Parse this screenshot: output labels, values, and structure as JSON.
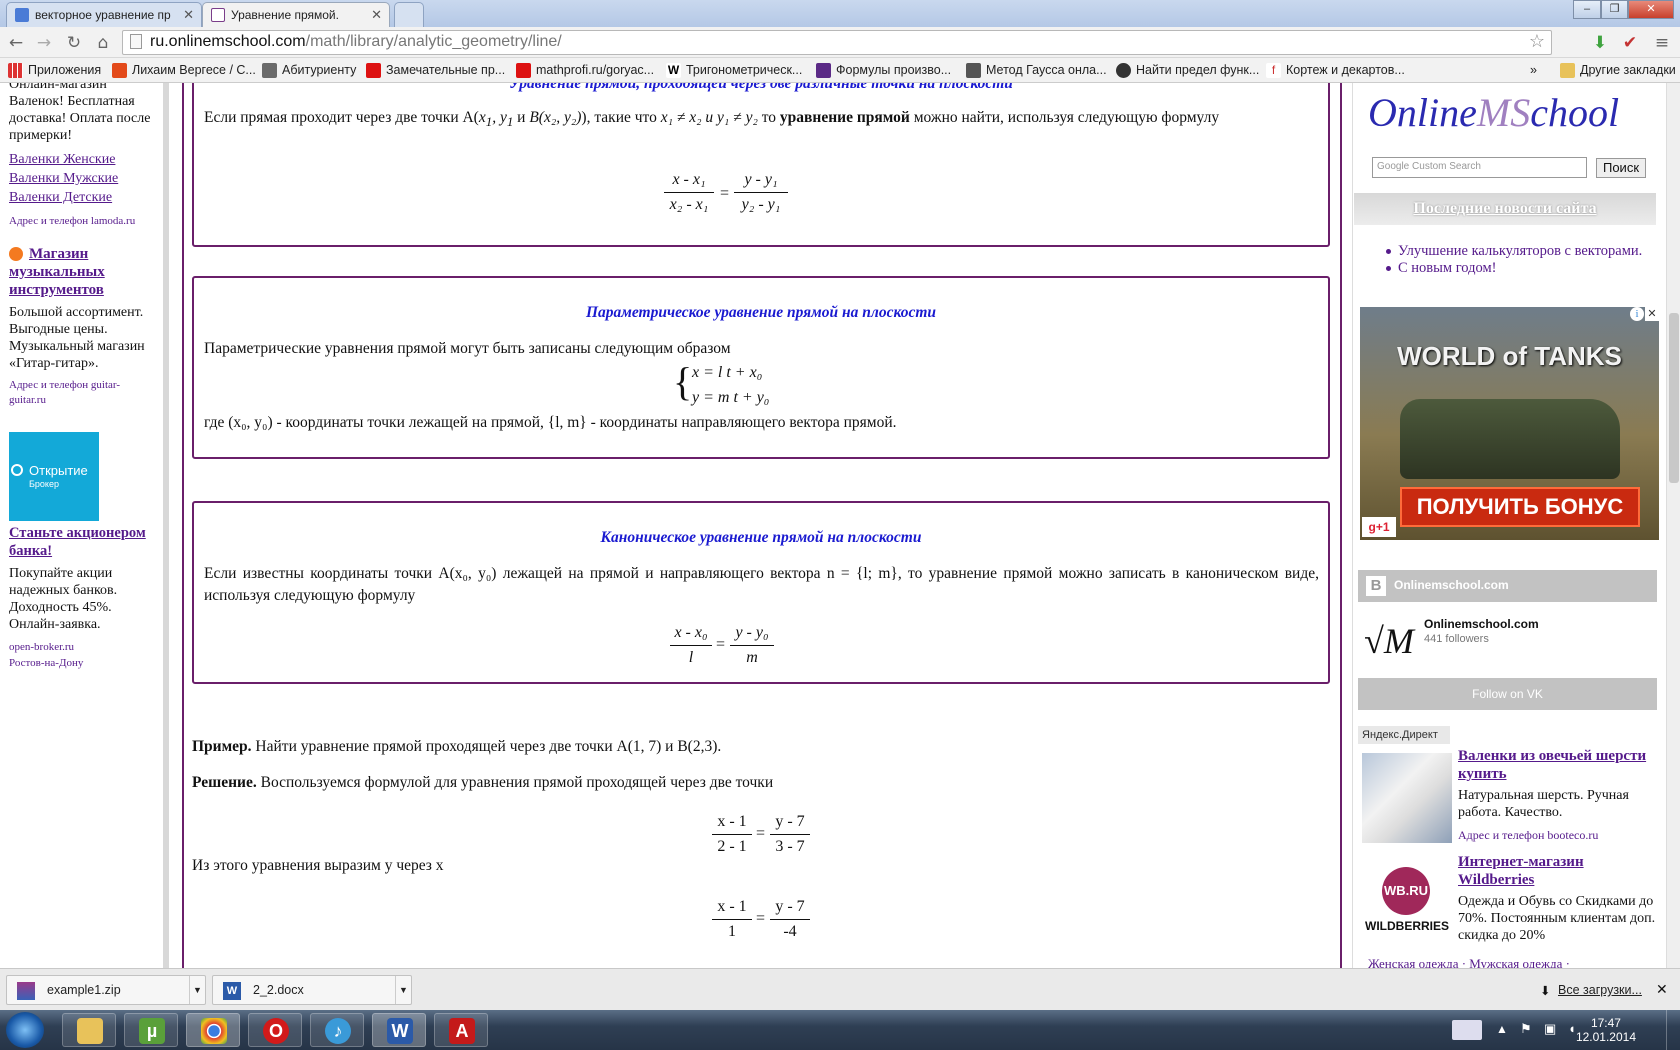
{
  "browser": {
    "tabs": [
      {
        "label": "векторное уравнение пр"
      },
      {
        "label": "Уравнение прямой."
      }
    ],
    "url_host": "ru.onlinemschool.com",
    "url_path": "/math/library/analytic_geometry/line/",
    "bookmarks": [
      "Приложения",
      "Лихаим Вергесе / С...",
      "Абитуриенту",
      "Замечательные пр...",
      "mathprofi.ru/goryac...",
      "Тригонометрическ...",
      "Формулы произво...",
      "Метод Гаусса онла...",
      "Найти предел функ...",
      "Кортеж и декартов..."
    ],
    "other_bookmarks": "Другие закладки",
    "overflow": "»"
  },
  "left_ads": {
    "ad1_text": "Онлайн-магазин Валенок! Бесплатная доставка! Оплата после примерки!",
    "ad1_links": [
      "Валенки Женские",
      "Валенки Мужские",
      "Валенки Детские"
    ],
    "ad1_contact": "Адрес и телефон  lamoda.ru",
    "ad2_title": "Магазин музыкальных инструментов",
    "ad2_text": "Большой ассортимент. Выгодные цены. Музыкальный магазин «Гитар-гитар».",
    "ad2_contact": "Адрес и телефон  guitar-guitar.ru",
    "ad3_banner_line1": "Открытие",
    "ad3_banner_line2": "Брокер",
    "ad3_title": "Станьте акционером банка!",
    "ad3_text": "Покупайте акции надежных банков. Доходность 45%. Онлайн-заявка.",
    "ad3_contact": "open-broker.ru",
    "ad3_city": "Ростов-на-Дону"
  },
  "main": {
    "box1": {
      "title": "Уравнение прямой, проходящей через две различные точки на плоскости",
      "text_a": "Если прямая проходит через две точки A(",
      "x1": "x",
      "text_b": "), такие что",
      "text_c": "то",
      "bold": "уравнение прямой",
      "text_d": "можно найти, используя следующую формулу",
      "frac_left_num": "x - x₁",
      "frac_left_den": "x₂ - x₁",
      "frac_right_num": "y - y₁",
      "frac_right_den": "y₂ - y₁",
      "point_a": "A(x₁, y₁)",
      "point_b": "B(x₂, y₂)",
      "cond": "x₁ ≠ x₂ и y₁ ≠ y₂"
    },
    "box2": {
      "title": "Параметрическое уравнение прямой на плоскости",
      "text1": "Параметрические уравнения прямой могут быть записаны следующим образом",
      "eq1": "x = l t + x₀",
      "eq2": "y = m t + y₀",
      "text2_a": "где (x₀, y₀) - координаты точки лежащей на прямой, {l, m} - координаты направляющего вектора прямой."
    },
    "box3": {
      "title": "Каноническое уравнение прямой на плоскости",
      "text1": "Если известны координаты точки A(x₀, y₀) лежащей на прямой и направляющего вектора n = {l; m}, то уравнение прямой можно записать в каноническом виде, используя следующую формулу",
      "frac_left_num": "x - x₀",
      "frac_left_den": "l",
      "frac_right_num": "y - y₀",
      "frac_right_den": "m"
    },
    "example_label": "Пример.",
    "example_text": "Найти уравнение прямой проходящей через две точки A(1, 7) и B(2,3).",
    "solution_label": "Решение.",
    "solution_text": "Воспользуемся формулой для уравнения прямой проходящей через две точки",
    "sol_frac1": {
      "ln": "x - 1",
      "ld": "2 - 1",
      "rn": "y - 7",
      "rd": "3 - 7"
    },
    "express_text": "Из этого уравнения выразим y через x",
    "sol_frac2": {
      "ln": "x - 1",
      "ld": "1",
      "rn": "y - 7",
      "rd": "-4"
    },
    "equals": "="
  },
  "right": {
    "logo_a": "Online",
    "logo_b": "MS",
    "logo_c": "chool",
    "search_placeholder": "Custom Search",
    "search_google": "Google",
    "search_button": "Поиск",
    "news_header": "Последние новости сайта",
    "news": [
      "Улучшение калькуляторов с векторами.",
      "С новым годом!"
    ],
    "banner_title": "WORLD of TANKS",
    "banner_cta": "ПОЛУЧИТЬ БОНУС",
    "banner_gplus": "g+1",
    "vk_header": "Onlinemschool.com",
    "vk_name": "Onlinemschool.com",
    "vk_followers": "441 followers",
    "vk_button": "Follow on VK",
    "yandex_label": "Яндекс.Директ",
    "ad1_title": "Валенки из овечьей шерсти купить",
    "ad1_text": "Натуральная шерсть. Ручная работа. Качество.",
    "ad1_contact": "Адрес и телефон  booteco.ru",
    "ad2_title": "Интернет-магазин Wildberries",
    "ad2_text": "Одежда и Обувь со Скидками до 70%. Постоянным клиентам доп. скидка до 20%",
    "ad2_links": "Женская одежда  ·  Мужская одежда  ·",
    "wb_logo": "WB.RU",
    "wb_brand": "WILDBERRIES"
  },
  "downloads": {
    "items": [
      "example1.zip",
      "2_2.docx"
    ],
    "all": "Все загрузки..."
  },
  "taskbar": {
    "time": "17:47",
    "date": "12.01.2014"
  }
}
